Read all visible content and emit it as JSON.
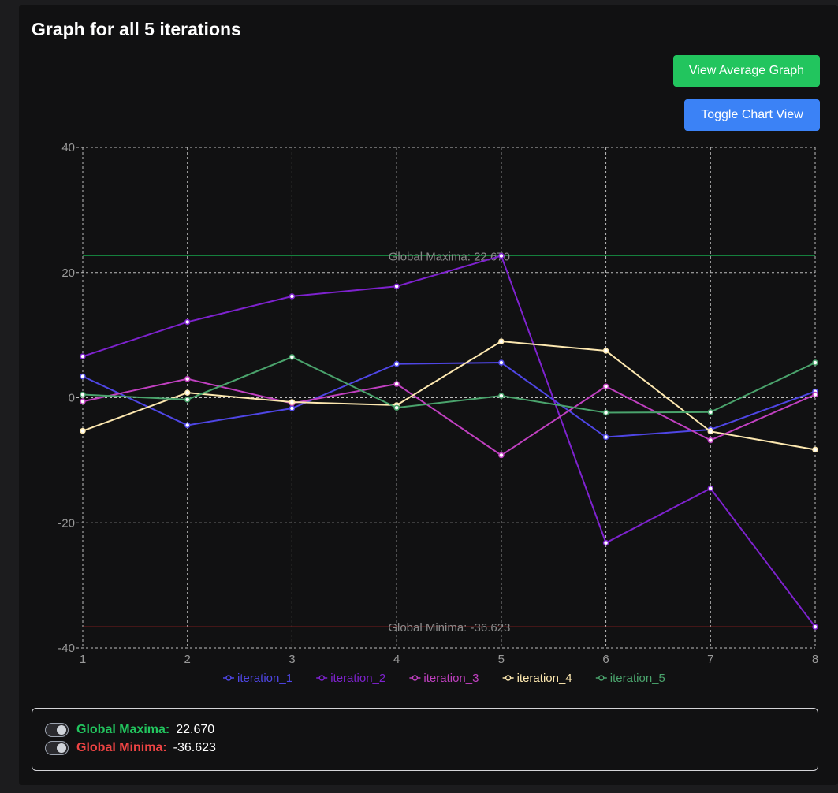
{
  "panel": {
    "title": "Graph for all 5 iterations",
    "view_average_label": "View Average Graph",
    "toggle_view_label": "Toggle Chart View"
  },
  "chart_data": {
    "type": "line",
    "x": [
      1,
      2,
      3,
      4,
      5,
      6,
      7,
      8
    ],
    "xlim": [
      1,
      8
    ],
    "ylim": [
      -40,
      40
    ],
    "yticks": [
      -40,
      -20,
      0,
      20,
      40
    ],
    "grid": true,
    "legend_position": "bottom",
    "series": [
      {
        "name": "iteration_1",
        "color": "#4f46e5",
        "values": [
          3.4,
          -4.4,
          -1.7,
          5.4,
          5.6,
          -6.3,
          -5.1,
          1.0
        ]
      },
      {
        "name": "iteration_2",
        "color": "#7e22ce",
        "values": [
          6.6,
          12.1,
          16.2,
          17.8,
          22.67,
          -23.2,
          -14.5,
          -36.623
        ]
      },
      {
        "name": "iteration_3",
        "color": "#c040c0",
        "values": [
          -0.6,
          3.0,
          -0.9,
          2.2,
          -9.2,
          1.8,
          -6.8,
          0.5
        ]
      },
      {
        "name": "iteration_4",
        "color": "#fde8b0",
        "values": [
          -5.3,
          0.8,
          -0.7,
          -1.2,
          9.0,
          7.5,
          -5.4,
          -8.3
        ]
      },
      {
        "name": "iteration_5",
        "color": "#4aa36c",
        "values": [
          0.5,
          -0.3,
          6.5,
          -1.6,
          0.3,
          -2.4,
          -2.3,
          5.6
        ]
      }
    ],
    "annotations": [
      {
        "label": "Global Maxima: 22.670",
        "value": 22.67,
        "color": "#15803d"
      },
      {
        "label": "Global Minima: -36.623",
        "value": -36.623,
        "color": "#dc2626"
      }
    ]
  },
  "stats": {
    "max_label": "Global Maxima:",
    "max_value": "22.670",
    "min_label": "Global Minima:",
    "min_value": "-36.623"
  }
}
